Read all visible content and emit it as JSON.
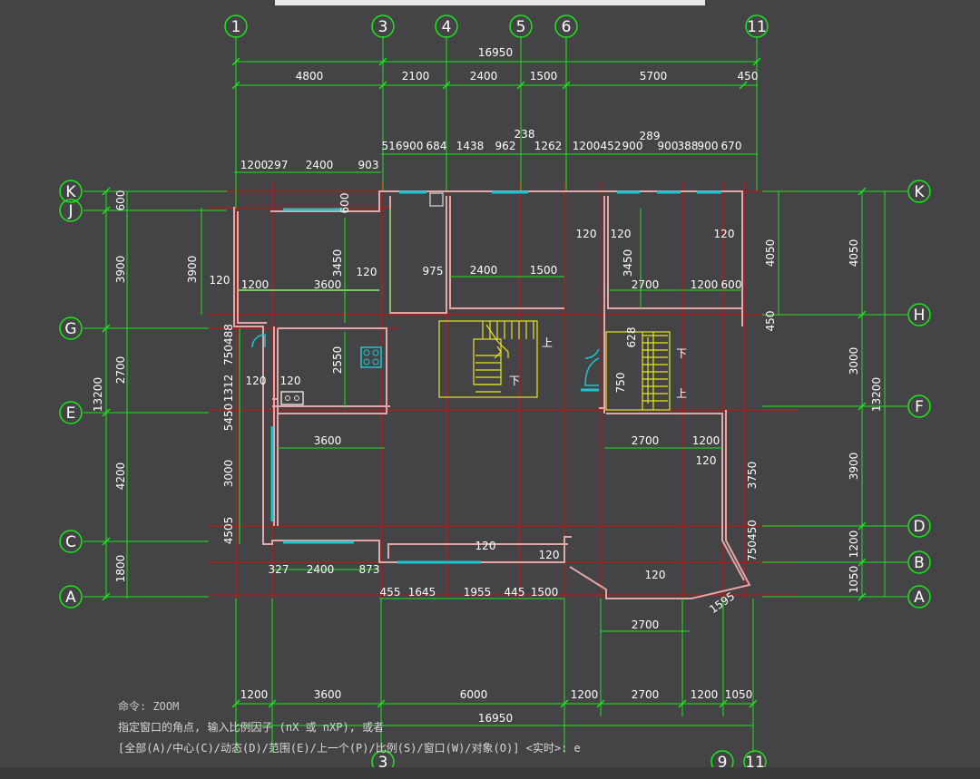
{
  "window": {
    "title": ""
  },
  "axes": {
    "top": [
      "1",
      "3",
      "4",
      "5",
      "6",
      "11"
    ],
    "bottom": [
      "3",
      "9",
      "11"
    ],
    "left": [
      "K",
      "J",
      "G",
      "E",
      "C",
      "A"
    ],
    "right": [
      "K",
      "H",
      "F",
      "D",
      "B",
      "A"
    ]
  },
  "dims": {
    "top_total": "16950",
    "top_row1": [
      "4800",
      "2100",
      "2400",
      "1500",
      "5700",
      "450"
    ],
    "top_row2": [
      "516",
      "900",
      "684",
      "1438",
      "962",
      "1262",
      "1200",
      "452",
      "900",
      "289",
      "900",
      "388",
      "900",
      "670",
      "238"
    ],
    "top_row3": [
      "1200",
      "297",
      "2400",
      "903"
    ],
    "left_outer": [
      "600",
      "3900",
      "2700",
      "4200",
      "1800",
      "13200"
    ],
    "left_inner": [
      "3900"
    ],
    "right_outer": [
      "4050",
      "3000",
      "3900",
      "1200",
      "1050",
      "13200"
    ],
    "right_inner": [
      "4050",
      "450",
      "3750",
      "750450"
    ],
    "interior": [
      "120",
      "600",
      "3450",
      "3600",
      "1200",
      "975",
      "2400",
      "1500",
      "2700",
      "600",
      "750488",
      "2550",
      "1312",
      "5450",
      "3000",
      "4505",
      "327",
      "873",
      "455",
      "1645",
      "1955",
      "445",
      "1500",
      "1595",
      "2700",
      "750",
      "628",
      "1200",
      "3750"
    ],
    "bottom_row1": [
      "1200",
      "3600",
      "6000",
      "1200",
      "2700",
      "1200",
      "1050"
    ],
    "bottom_total": "16950"
  },
  "stair": {
    "up": "上",
    "down": "下"
  },
  "command": {
    "line1": "命令: ZOOM",
    "line2": "指定窗口的角点, 输入比例因子 (nX 或 nXP), 或者",
    "line3": "[全部(A)/中心(C)/动态(D)/范围(E)/上一个(P)/比例(S)/窗口(W)/对象(O)] <实时>: e"
  },
  "colors": {
    "background": "#444446",
    "dimension": "#19e619",
    "axis_red": "#c01818",
    "wall": "#e8a0a0",
    "window": "#19c8d0",
    "stair": "#e6e619",
    "text": "#ffffff"
  }
}
